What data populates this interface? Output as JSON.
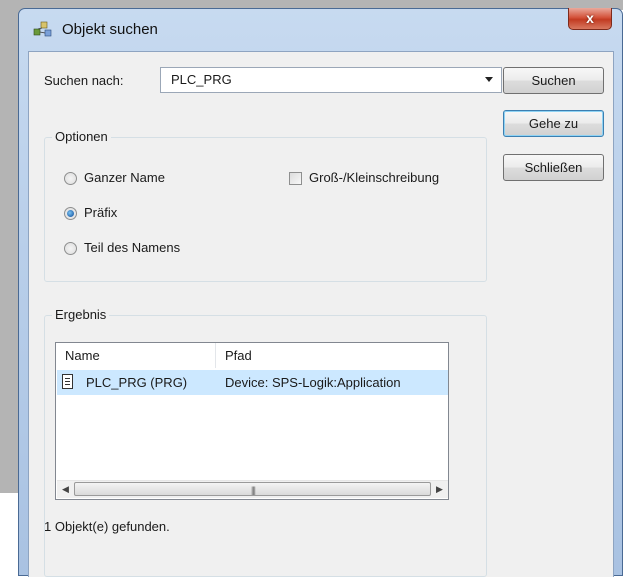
{
  "window": {
    "title": "Objekt suchen",
    "close_label": "x"
  },
  "search": {
    "label": "Suchen nach:",
    "value": "PLC_PRG"
  },
  "buttons": {
    "search": "Suchen",
    "goto": "Gehe zu",
    "close": "Schließen"
  },
  "options": {
    "title": "Optionen",
    "match_whole": "Ganzer Name",
    "prefix": "Präfix",
    "part_of_name": "Teil des Namens",
    "case_sensitive": "Groß-/Kleinschreibung",
    "selected": "prefix",
    "case_checked": false
  },
  "result": {
    "title": "Ergebnis",
    "columns": [
      "Name",
      "Pfad"
    ],
    "rows": [
      {
        "name": "PLC_PRG (PRG)",
        "path": "Device: SPS-Logik:Application",
        "icon": "document-icon",
        "selected": true
      }
    ],
    "status": "1 Objekt(e) gefunden."
  },
  "colors": {
    "selection": "#cce8ff",
    "titlebar": "#b9cfea",
    "close": "#c23b22"
  }
}
